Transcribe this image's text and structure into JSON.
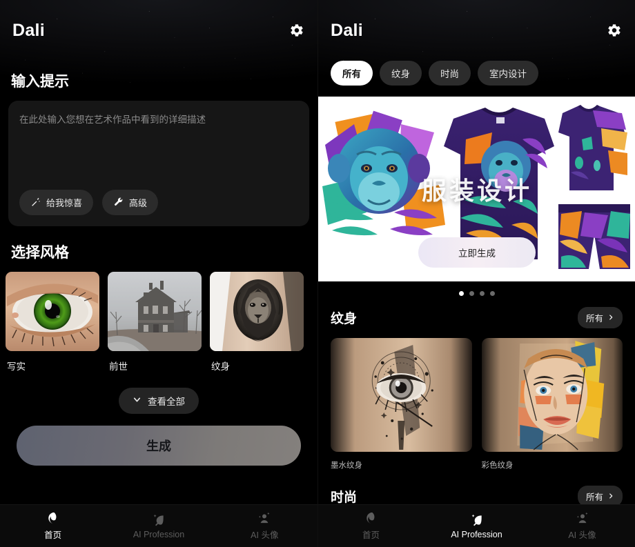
{
  "app": {
    "title": "Dali",
    "settings_icon": "gear-icon"
  },
  "left": {
    "prompt_section_title": "输入提示",
    "prompt_placeholder": "在此处输入您想在艺术作品中看到的详细描述",
    "prompt_value": "",
    "chips": [
      {
        "label": "给我惊喜",
        "icon": "magic-wand-icon"
      },
      {
        "label": "高级",
        "icon": "wrench-icon"
      }
    ],
    "styles_section_title": "选择风格",
    "styles": [
      {
        "label": "写实",
        "image": "green-eye-closeup"
      },
      {
        "label": "前世",
        "image": "foggy-victorian-house"
      },
      {
        "label": "纹身",
        "image": "lion-tattoo-on-arm"
      }
    ],
    "view_all_label": "查看全部",
    "generate_label": "生成"
  },
  "right": {
    "tabs": [
      {
        "label": "所有",
        "active": true
      },
      {
        "label": "纹身",
        "active": false
      },
      {
        "label": "时尚",
        "active": false
      },
      {
        "label": "室内设计",
        "active": false
      }
    ],
    "hero": {
      "title": "服装设计",
      "cta_label": "立即生成",
      "image": "purple-chimpanzee-apparel-design"
    },
    "carousel_dots": 4,
    "carousel_active_dot": 1,
    "sections": [
      {
        "name": "纹身",
        "more_label": "所有",
        "cards": [
          {
            "caption": "墨水纹身",
            "image": "blackwork-eye-tattoo"
          },
          {
            "caption": "彩色纹身",
            "image": "colorful-portrait-tattoo"
          }
        ]
      },
      {
        "name": "时尚",
        "more_label": "所有",
        "cards": []
      }
    ]
  },
  "bottom_nav": {
    "left": [
      {
        "label": "首页",
        "icon": "moon-swirl-icon",
        "active": true
      },
      {
        "label": "AI Profession",
        "icon": "leaf-sparkle-icon",
        "active": false
      },
      {
        "label": "AI 头像",
        "icon": "person-sparkle-icon",
        "active": false
      }
    ],
    "right": [
      {
        "label": "首页",
        "icon": "moon-swirl-icon",
        "active": false
      },
      {
        "label": "AI Profession",
        "icon": "leaf-sparkle-icon",
        "active": true
      },
      {
        "label": "AI 头像",
        "icon": "person-sparkle-icon",
        "active": false
      }
    ]
  },
  "colors": {
    "background": "#000000",
    "card": "#161616",
    "chip": "#2b2b2b",
    "accent_white": "#ffffff",
    "muted_text": "#8a8a8a",
    "nav_inactive": "#5d5d5d"
  }
}
